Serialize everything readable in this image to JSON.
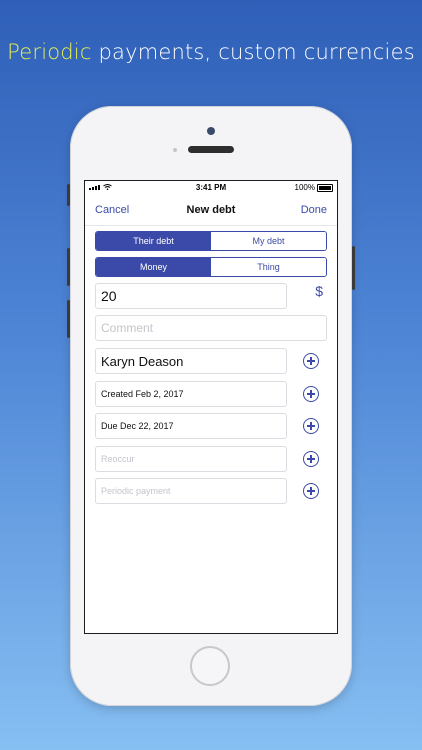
{
  "headline": {
    "highlight": "Periodic",
    "rest": " payments, custom currencies"
  },
  "status": {
    "time": "3:41 PM",
    "battery": "100%"
  },
  "nav": {
    "cancel": "Cancel",
    "title": "New debt",
    "done": "Done"
  },
  "debt_type": {
    "options": [
      "Their debt",
      "My debt"
    ],
    "selected": "Their debt"
  },
  "item_type": {
    "options": [
      "Money",
      "Thing"
    ],
    "selected": "Money"
  },
  "amount": {
    "value": "20",
    "currency_symbol": "$"
  },
  "comment": {
    "placeholder": "Comment"
  },
  "person": {
    "value": "Karyn Deason"
  },
  "created": {
    "value": "Created Feb 2, 2017"
  },
  "due": {
    "value": "Due Dec 22, 2017"
  },
  "reoccur": {
    "placeholder": "Reoccur"
  },
  "periodic_payment": {
    "placeholder": "Periodic payment"
  },
  "icons": {
    "add": "plus-circle-icon",
    "signal": "signal-icon",
    "wifi": "wifi-icon",
    "battery": "battery-icon"
  },
  "colors": {
    "accent": "#3b4aa8",
    "headline_highlight": "#e6ef53"
  }
}
